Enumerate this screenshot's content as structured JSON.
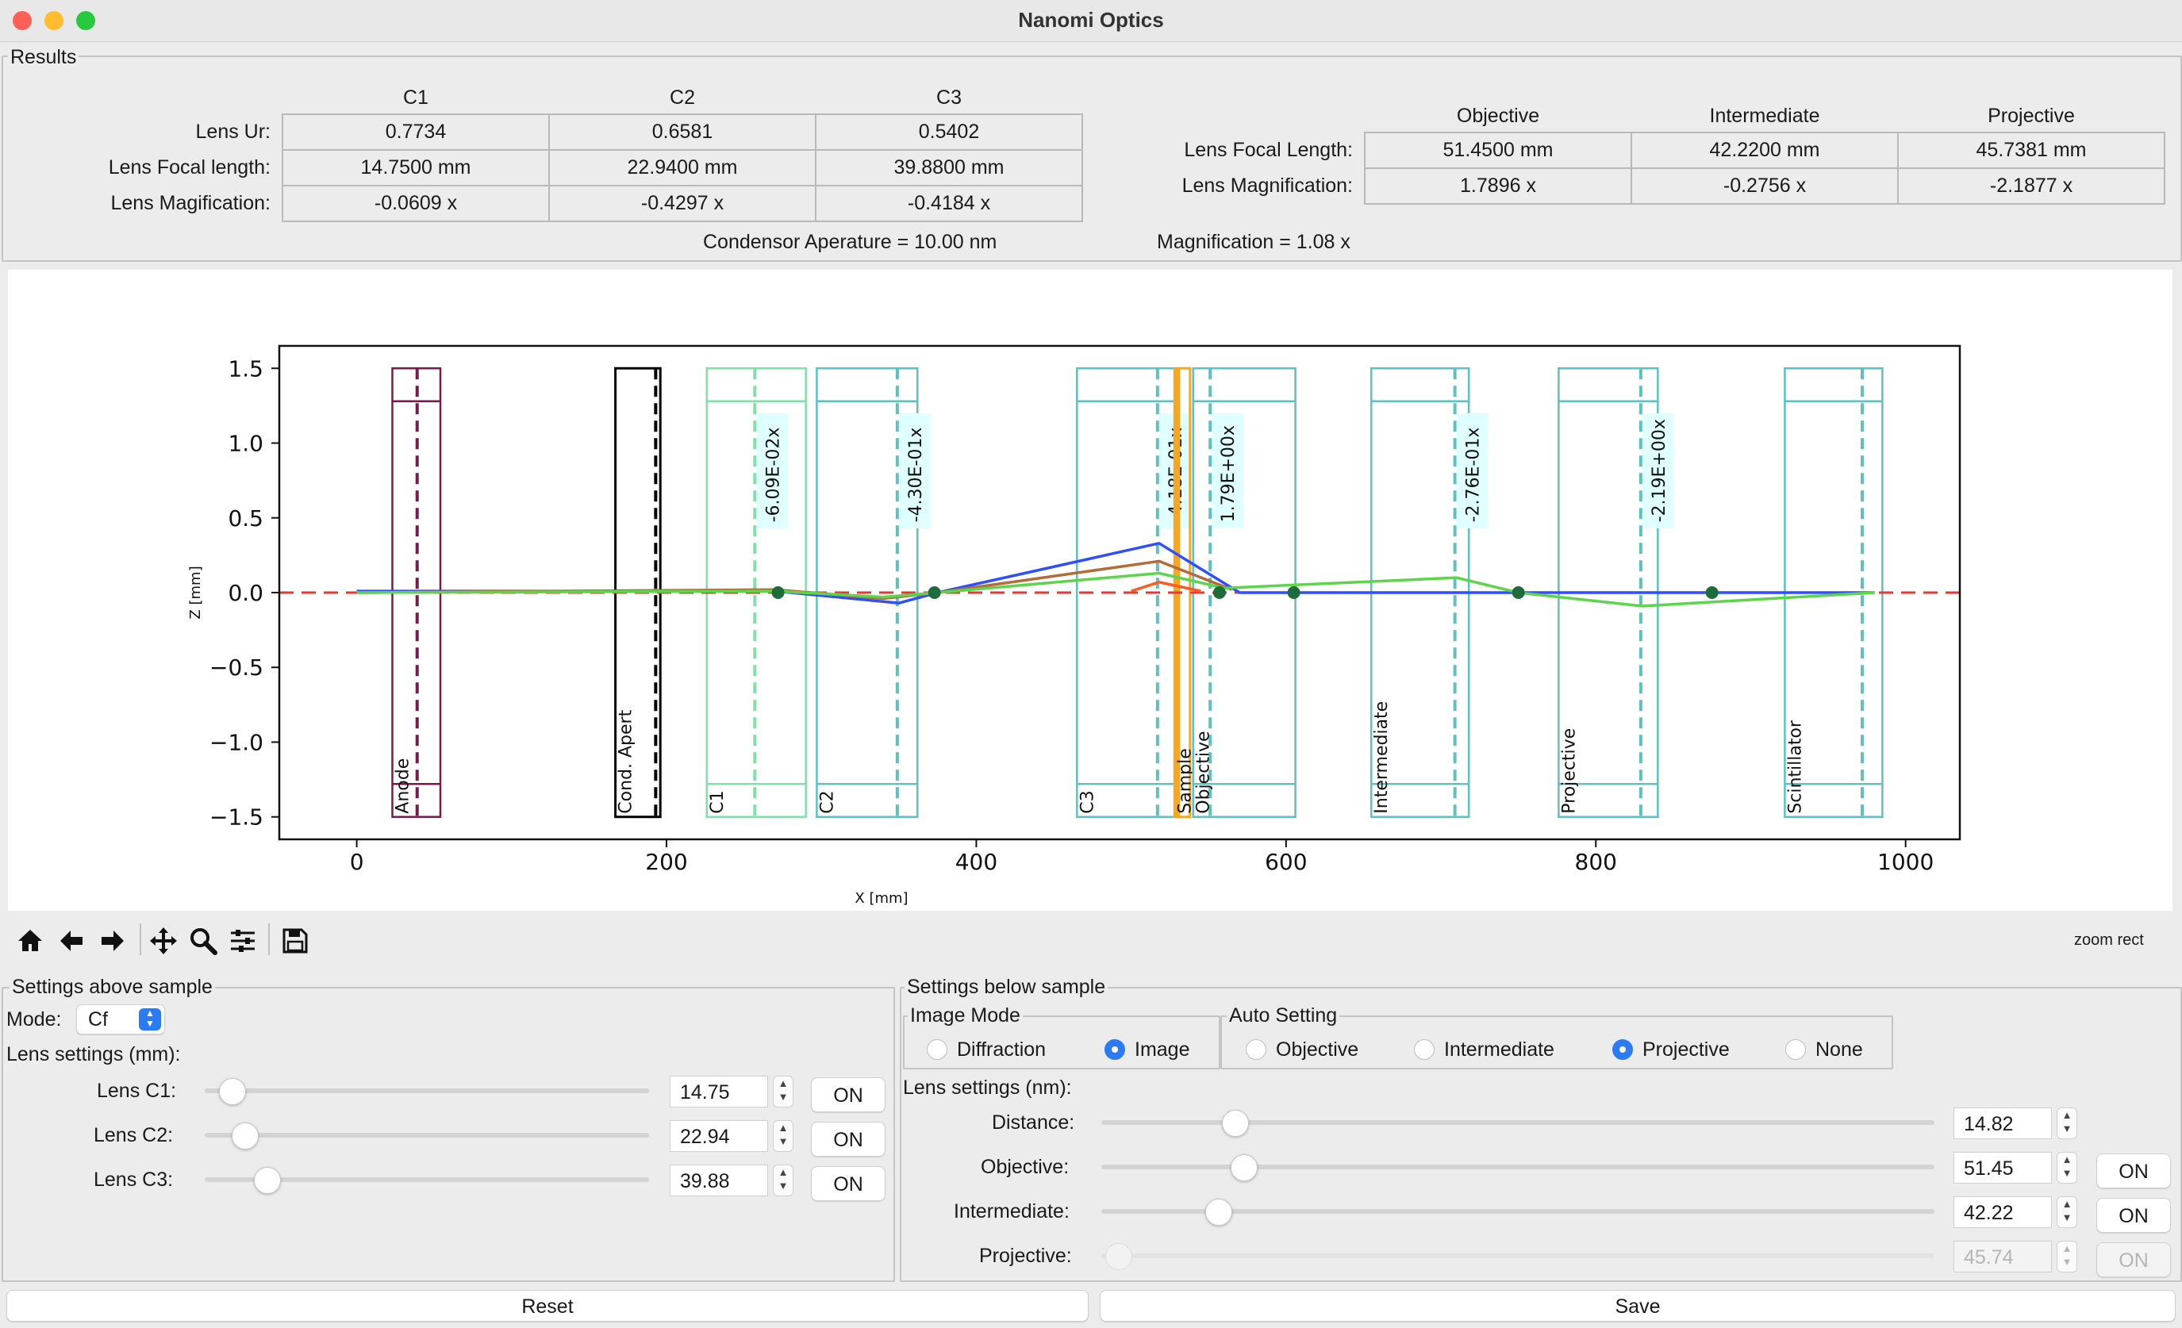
{
  "window": {
    "title": "Nanomi Optics"
  },
  "results": {
    "group_title": "Results",
    "condenser": {
      "headers": [
        "C1",
        "C2",
        "C3"
      ],
      "rows": [
        {
          "label": "Lens Ur:",
          "values": [
            "0.7734",
            "0.6581",
            "0.5402"
          ]
        },
        {
          "label": "Lens Focal length:",
          "values": [
            "14.7500 mm",
            "22.9400 mm",
            "39.8800 mm"
          ]
        },
        {
          "label": "Lens Magification:",
          "values": [
            "-0.0609 x",
            "-0.4297 x",
            "-0.4184 x"
          ]
        }
      ]
    },
    "imaging": {
      "headers": [
        "Objective",
        "Intermediate",
        "Projective"
      ],
      "rows": [
        {
          "label": "Lens Focal Length:",
          "values": [
            "51.4500 mm",
            "42.2200 mm",
            "45.7381 mm"
          ]
        },
        {
          "label": "Lens Magnification:",
          "values": [
            "1.7896 x",
            "-0.2756 x",
            "-2.1877 x"
          ]
        }
      ]
    },
    "condenser_aperture": "Condensor Aperature = 10.00 nm",
    "magnification": "Magnification = 1.08 x"
  },
  "chart_data": {
    "type": "line",
    "xlabel": "X [mm]",
    "ylabel": "Z [mm]",
    "xlim": [
      -50,
      1035
    ],
    "ylim": [
      -1.65,
      1.65
    ],
    "xticks": [
      0,
      200,
      400,
      600,
      800,
      1000
    ],
    "yticks": [
      1.5,
      1.0,
      0.5,
      0.0,
      -0.5,
      -1.0,
      -1.5
    ],
    "optical_axis": {
      "y": 0,
      "color": "#e53935",
      "style": "dashed"
    },
    "elements": [
      {
        "name": "Anode",
        "x0": 23,
        "x1": 54,
        "center": 39,
        "color": "#7a1a4a"
      },
      {
        "name": "Cond. Apert",
        "x0": 167,
        "x1": 196,
        "center": 193,
        "color": "#000000"
      },
      {
        "name": "C1",
        "x0": 226,
        "x1": 290,
        "center": 257,
        "color": "#7fe0a8",
        "annotation": "-6.09E-02x"
      },
      {
        "name": "C2",
        "x0": 297,
        "x1": 362,
        "center": 349,
        "color": "#5ec0c0",
        "annotation": "-4.30E-01x"
      },
      {
        "name": "C3",
        "x0": 465,
        "x1": 528,
        "center": 517,
        "color": "#5ec0c0",
        "annotation": "-4.18E-01x"
      },
      {
        "name": "Sample",
        "x0": 528,
        "x1": 538,
        "center": 528,
        "color": "#f5a623"
      },
      {
        "name": "Objective",
        "x0": 540,
        "x1": 606,
        "center": 551,
        "color": "#5ec0c0",
        "annotation": "1.79E+00x"
      },
      {
        "name": "Intermediate",
        "x0": 655,
        "x1": 718,
        "center": 709,
        "color": "#5ec0c0",
        "annotation": "-2.76E-01x"
      },
      {
        "name": "Projective",
        "x0": 776,
        "x1": 840,
        "center": 829,
        "color": "#5ec0c0",
        "annotation": "-2.19E+00x"
      },
      {
        "name": "Scintillator",
        "x0": 922,
        "x1": 985,
        "center": 972,
        "color": "#5ec0c0"
      }
    ],
    "series": [
      {
        "color": "#2f4fff",
        "x": [
          0,
          270,
          350,
          375,
          518,
          570,
          980
        ],
        "y": [
          0.01,
          0.01,
          -0.07,
          0,
          0.33,
          0,
          0
        ]
      },
      {
        "color": "#b56a3a",
        "x": [
          0,
          270,
          340,
          375,
          518,
          565
        ],
        "y": [
          0,
          0.02,
          -0.04,
          0,
          0.21,
          0.02
        ]
      },
      {
        "color": "#5bd64a",
        "x": [
          0,
          270,
          340,
          375,
          518,
          560,
          710,
          750,
          830,
          980
        ],
        "y": [
          0,
          0.01,
          -0.03,
          0,
          0.13,
          0.03,
          0.1,
          0,
          -0.09,
          0
        ]
      },
      {
        "color": "#ff5a1f",
        "x": [
          500,
          518,
          545
        ],
        "y": [
          0.01,
          0.07,
          0.01
        ]
      }
    ],
    "focal_points": {
      "color": "#1e6b3c",
      "x": [
        272,
        373,
        557,
        605,
        750,
        875
      ],
      "y": [
        0,
        0,
        0,
        0,
        0,
        0
      ]
    }
  },
  "toolbar": {
    "icons": [
      "home-icon",
      "back-icon",
      "forward-icon",
      "pan-icon",
      "zoom-icon",
      "configure-icon",
      "save-icon"
    ],
    "mode_text": "zoom rect"
  },
  "settings_above": {
    "group_title": "Settings above sample",
    "mode_label": "Mode:",
    "mode_value": "Cf",
    "lens_settings_label": "Lens settings (mm):",
    "lenses": [
      {
        "label": "Lens C1:",
        "value": "14.75",
        "slider": 0.06,
        "button": "ON"
      },
      {
        "label": "Lens C2:",
        "value": "22.94",
        "slider": 0.09,
        "button": "ON"
      },
      {
        "label": "Lens C3:",
        "value": "39.88",
        "slider": 0.14,
        "button": "ON"
      }
    ]
  },
  "settings_below": {
    "group_title": "Settings below sample",
    "image_mode": {
      "title": "Image Mode",
      "options": [
        "Diffraction",
        "Image"
      ],
      "selected": "Image"
    },
    "auto_setting": {
      "title": "Auto Setting",
      "options": [
        "Objective",
        "Intermediate",
        "Projective",
        "None"
      ],
      "selected": "Projective"
    },
    "lens_settings_label": "Lens settings (nm):",
    "lenses": [
      {
        "label": "Distance:",
        "value": "14.82",
        "slider": 0.16,
        "button": ""
      },
      {
        "label": "Objective:",
        "value": "51.45",
        "slider": 0.17,
        "button": "ON"
      },
      {
        "label": "Intermediate:",
        "value": "42.22",
        "slider": 0.14,
        "button": "ON"
      },
      {
        "label": "Projective:",
        "value": "45.74",
        "slider": 0.02,
        "button": "ON",
        "disabled": true
      }
    ]
  },
  "footer": {
    "reset_label": "Reset",
    "save_label": "Save"
  }
}
